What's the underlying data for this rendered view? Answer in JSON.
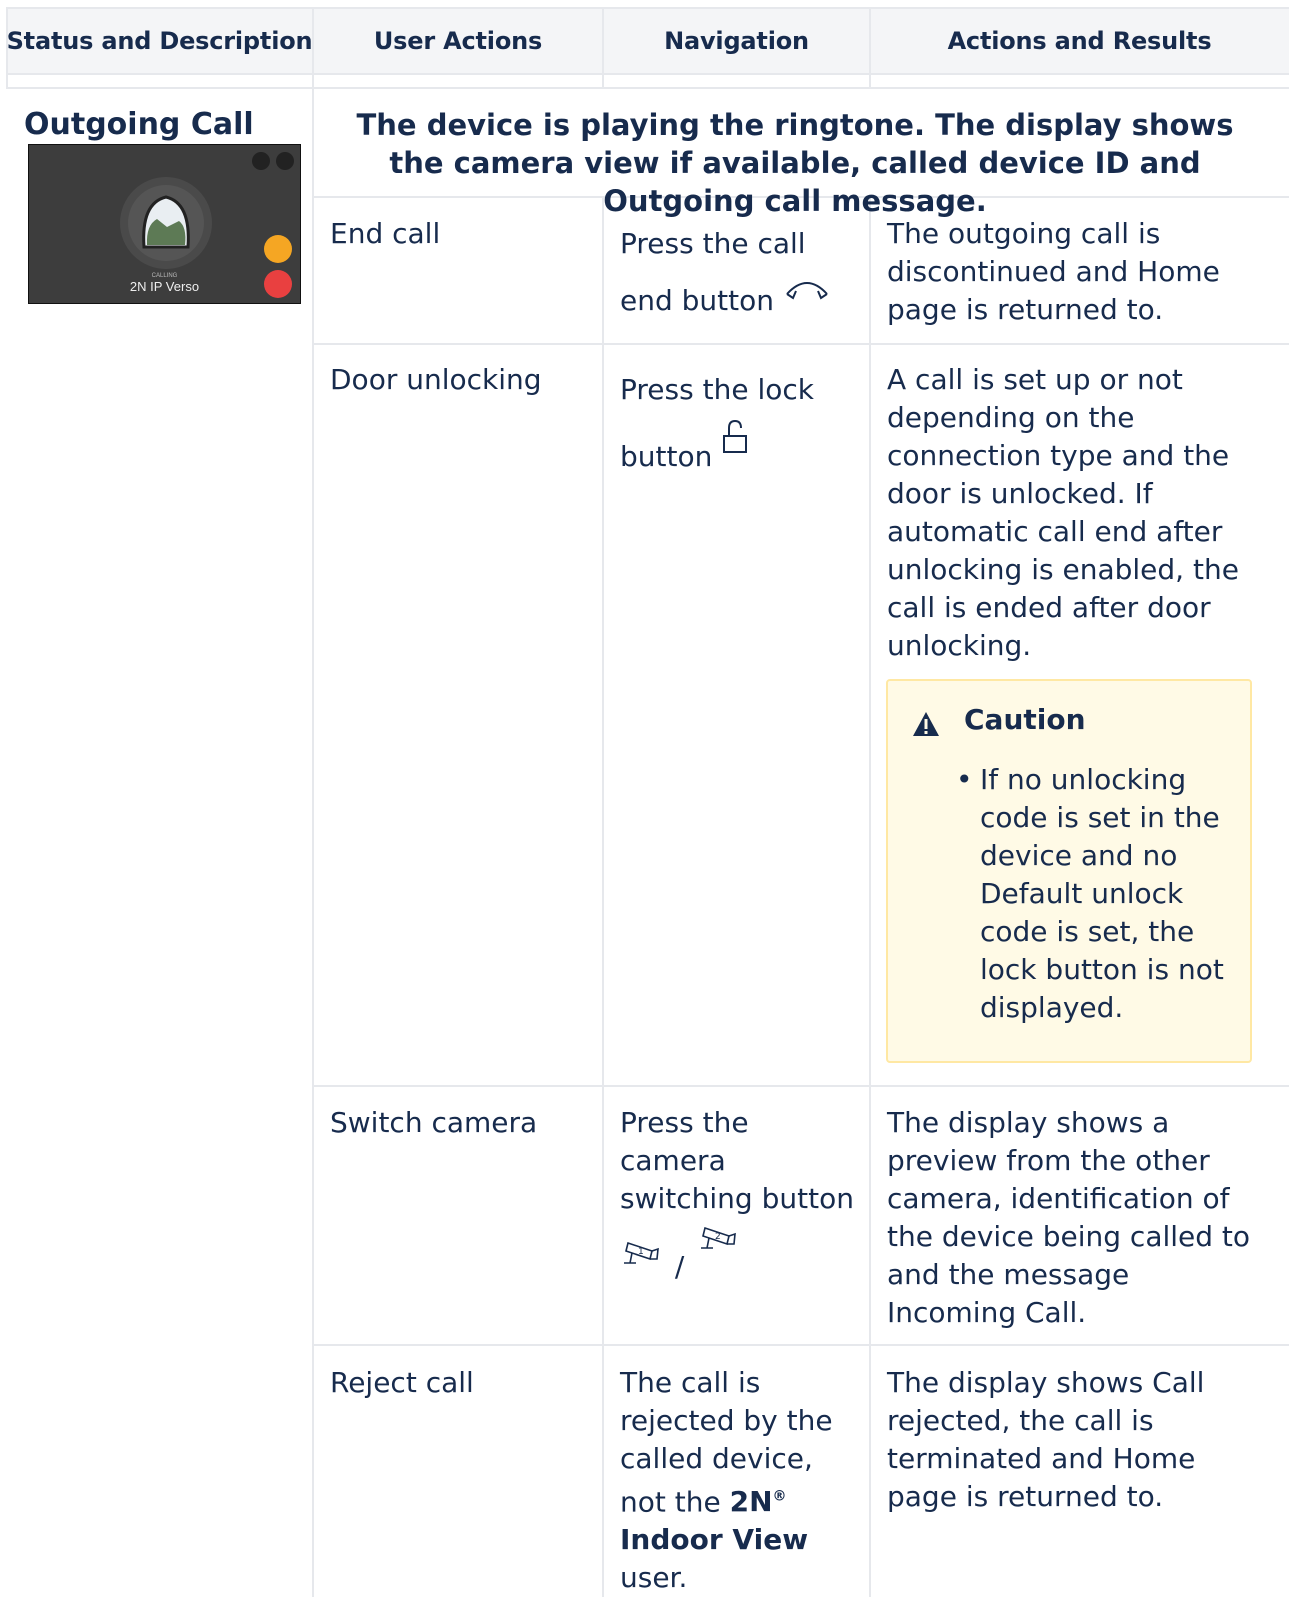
{
  "headers": [
    "Status and Description",
    "User Actions",
    "Navigation",
    "Actions and Results"
  ],
  "section": {
    "title": "Outgoing Call",
    "description": "The device is playing the ringtone. The display shows the camera view if available, called device ID and Outgoing call message.",
    "thumbnail": {
      "calling_label": "CALLING",
      "device_name": "2N IP Verso"
    }
  },
  "rows": [
    {
      "action": "End call",
      "navigation": "Press the call end button",
      "result": "The outgoing call is discontinued and Home page is returned to."
    },
    {
      "action": "Door unlocking",
      "navigation": "Press the lock button",
      "result": "A call is set up or not depending on the connection type and the door is unlocked. If automatic call end after unlocking is enabled, the call is ended after door unlocking."
    },
    {
      "action": "Switch camera",
      "navigation": "Press the camera switching button",
      "nav_separator": "/",
      "result": "The display shows a preview from the other camera, identification of the device being called to and the message Incoming Call."
    },
    {
      "action": "Reject call",
      "navigation_prefix": "The call is rejected by the called device, not the",
      "navigation_brand": "2N",
      "navigation_reg": "®",
      "navigation_brand_rest": "Indoor View",
      "navigation_suffix": "user.",
      "result": "The display shows Call rejected, the call is terminated and Home page is returned to."
    }
  ],
  "caution": {
    "title": "Caution",
    "item": "If no unlocking code is set in the device and no Default unlock code is set, the lock button is not displayed."
  },
  "colors": {
    "header_bg": "#f4f5f7",
    "caution_bg": "#fffae6",
    "caution_border": "#ffe8a3",
    "text": "#172b4d"
  }
}
